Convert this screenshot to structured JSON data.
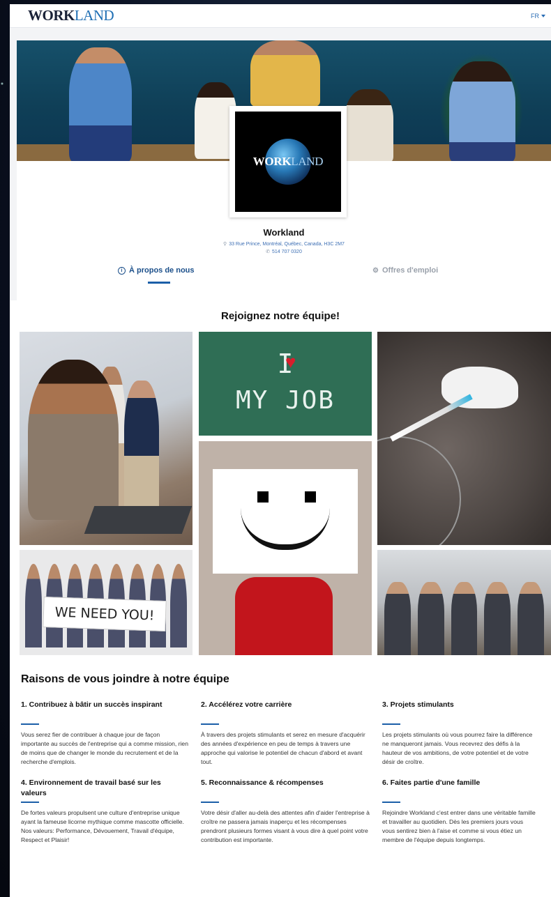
{
  "header": {
    "logo_part1": "WORK",
    "logo_part2": "LAND",
    "lang": "FR"
  },
  "company": {
    "logo_part1": "WORK",
    "logo_part2": "LAND",
    "name": "Workland",
    "address": "33 Rue Prince, Montréal, Québec, Canada, H3C 2M7",
    "phone": "514 707 0320"
  },
  "tabs": [
    {
      "label": "À propos de nous",
      "active": true
    },
    {
      "label": "Offres d'emploi",
      "active": false
    }
  ],
  "gallery": {
    "title": "Rejoignez notre équipe!",
    "chalk_line1": "I",
    "chalk_line2": "MY JOB",
    "sign_text": "WE NEED YOU!"
  },
  "reasons": {
    "title": "Raisons de vous joindre à notre équipe",
    "items": [
      {
        "title": "1. Contribuez à bâtir un succès inspirant",
        "text": "Vous serez fier de contribuer à chaque jour de façon importante au succès de l'entreprise qui a comme mission, rien de moins que de changer le monde du recrutement et de la recherche d'emplois."
      },
      {
        "title": "2. Accélérez votre carrière",
        "text": "À travers des projets stimulants et serez en mesure d'acquérir des années d'expérience en peu de temps à travers une approche qui valorise le potentiel de chacun d'abord et avant tout."
      },
      {
        "title": "3. Projets stimulants",
        "text": "Les projets stimulants où vous pourrez faire la différence ne manqueront jamais. Vous recevrez des défis à la hauteur de vos ambitions, de votre potentiel et de votre désir de croître."
      },
      {
        "title": "4. Environnement de travail basé sur les valeurs",
        "text": "De fortes valeurs propulsent une culture d'entreprise unique ayant la fameuse licorne mythique comme mascotte officielle. Nos valeurs: Performance, Dévouement, Travail d'équipe, Respect et Plaisir!"
      },
      {
        "title": "5. Reconnaissance & récompenses",
        "text": "Votre désir d'aller au-delà des attentes afin d'aider l'entreprise à croître ne passera jamais inaperçu et les récompenses prendront plusieurs formes visant à vous dire à quel point votre contribution est importante."
      },
      {
        "title": "6. Faites partie d'une famille",
        "text": "Rejoindre Workland c'est entrer dans une véritable famille et travailler au quotidien. Dès les premiers jours vous vous sentirez bien à l'aise et comme si vous étiez un membre de l'équipe depuis longtemps."
      }
    ]
  },
  "colors": {
    "accent": "#1b5fa8",
    "link": "#3d6fb4",
    "brand_dark": "#1a2238"
  }
}
